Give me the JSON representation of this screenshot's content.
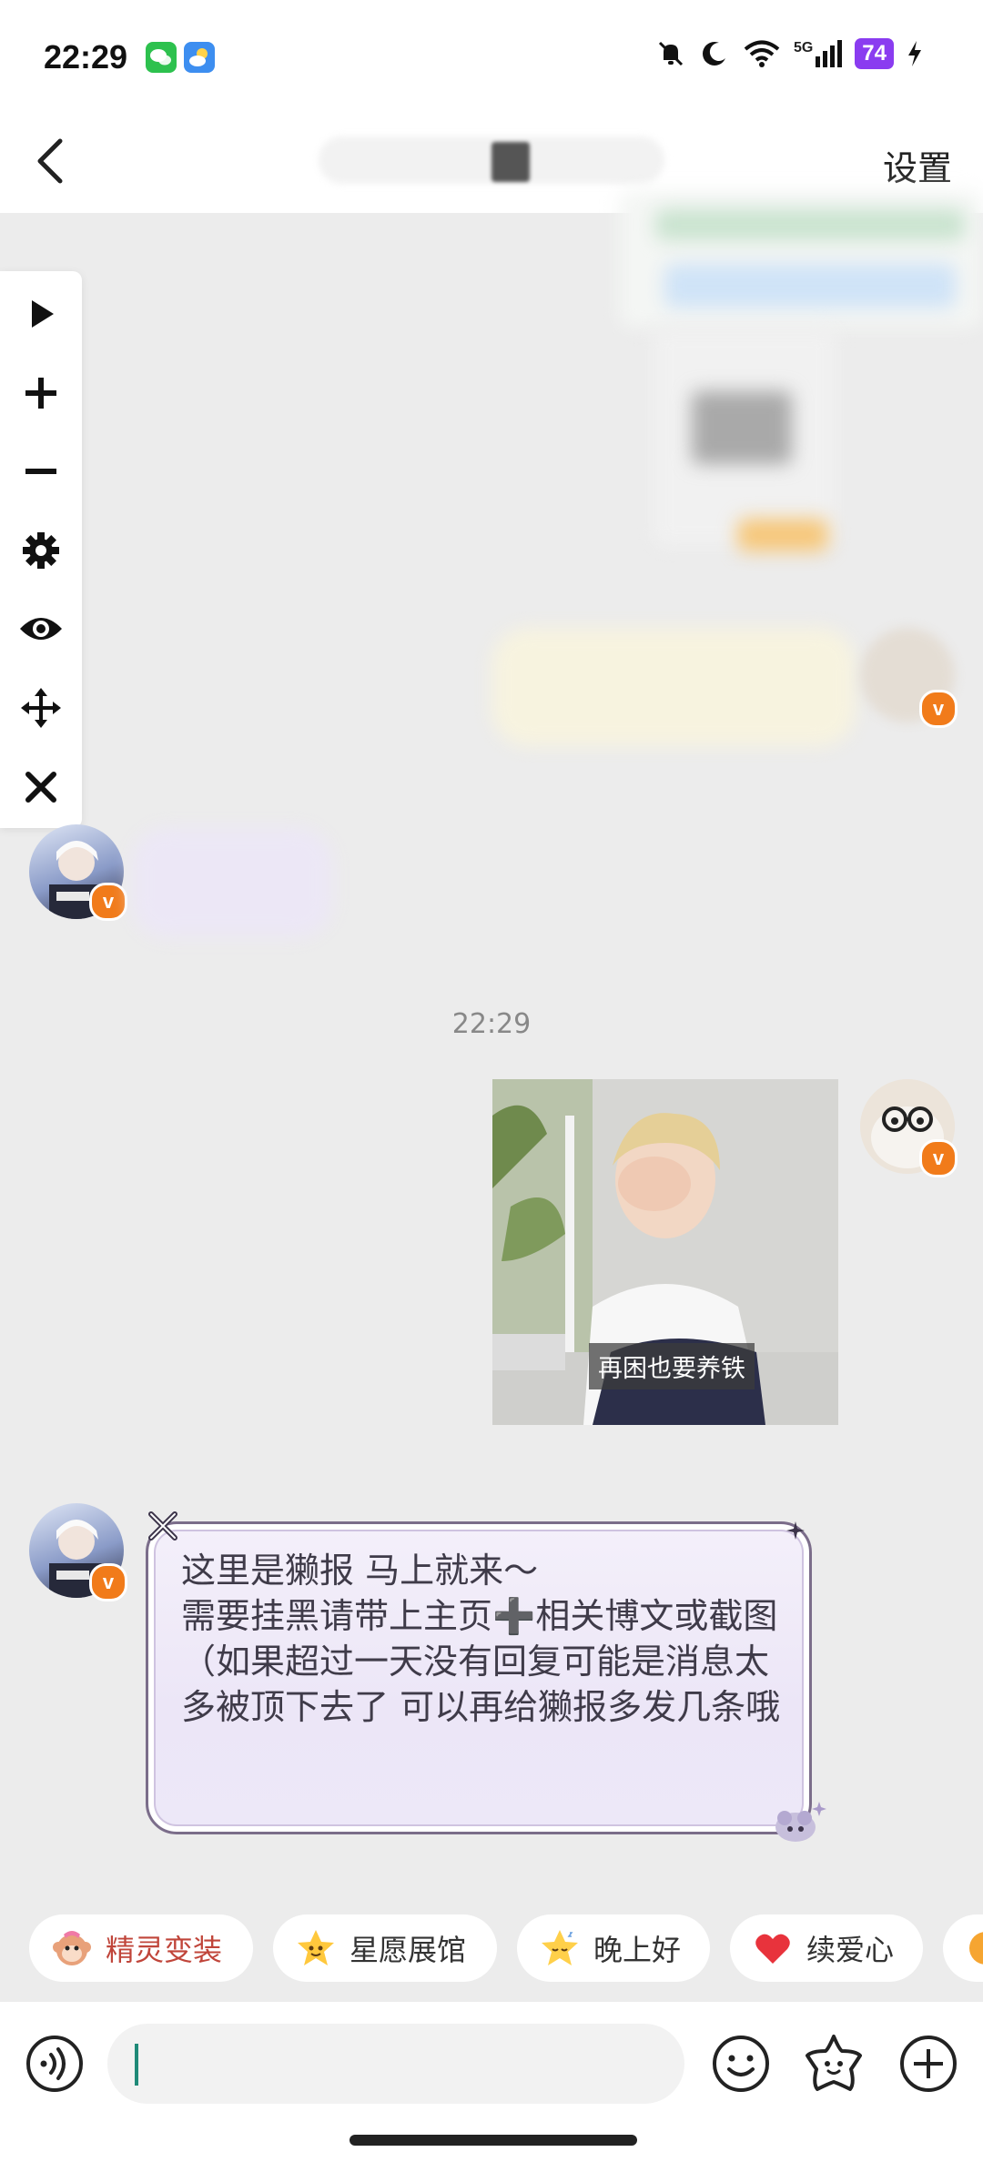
{
  "status_bar": {
    "time": "22:29",
    "battery": "74",
    "network": "5G"
  },
  "header": {
    "settings_label": "设置"
  },
  "toolbar": {
    "items": [
      "play-icon",
      "plus-icon",
      "minus-icon",
      "gear-icon",
      "eye-icon",
      "move-icon",
      "close-icon"
    ]
  },
  "chat": {
    "timestamp": "22:29",
    "sticker_caption": "再困也要养铁",
    "auto_reply": "这里是獭报 马上就来～\n需要挂黑请带上主页➕相关博文或截图\n（如果超过一天没有回复可能是消息太多被顶下去了 可以再给獭报多发几条哦"
  },
  "quick_chips": [
    {
      "label": "精灵变装",
      "icon": "monkey-emoji-icon",
      "color": "#c0453a"
    },
    {
      "label": "星愿展馆",
      "icon": "star-emoji-icon",
      "color": "#333333"
    },
    {
      "label": "晚上好",
      "icon": "sleepy-star-emoji-icon",
      "color": "#333333"
    },
    {
      "label": "续爱心",
      "icon": "heart-icon",
      "color": "#333333"
    }
  ],
  "colors": {
    "accent_caret": "#1f8a78",
    "verified_badge": "#f17b1a",
    "battery": "#8a3cf0"
  }
}
